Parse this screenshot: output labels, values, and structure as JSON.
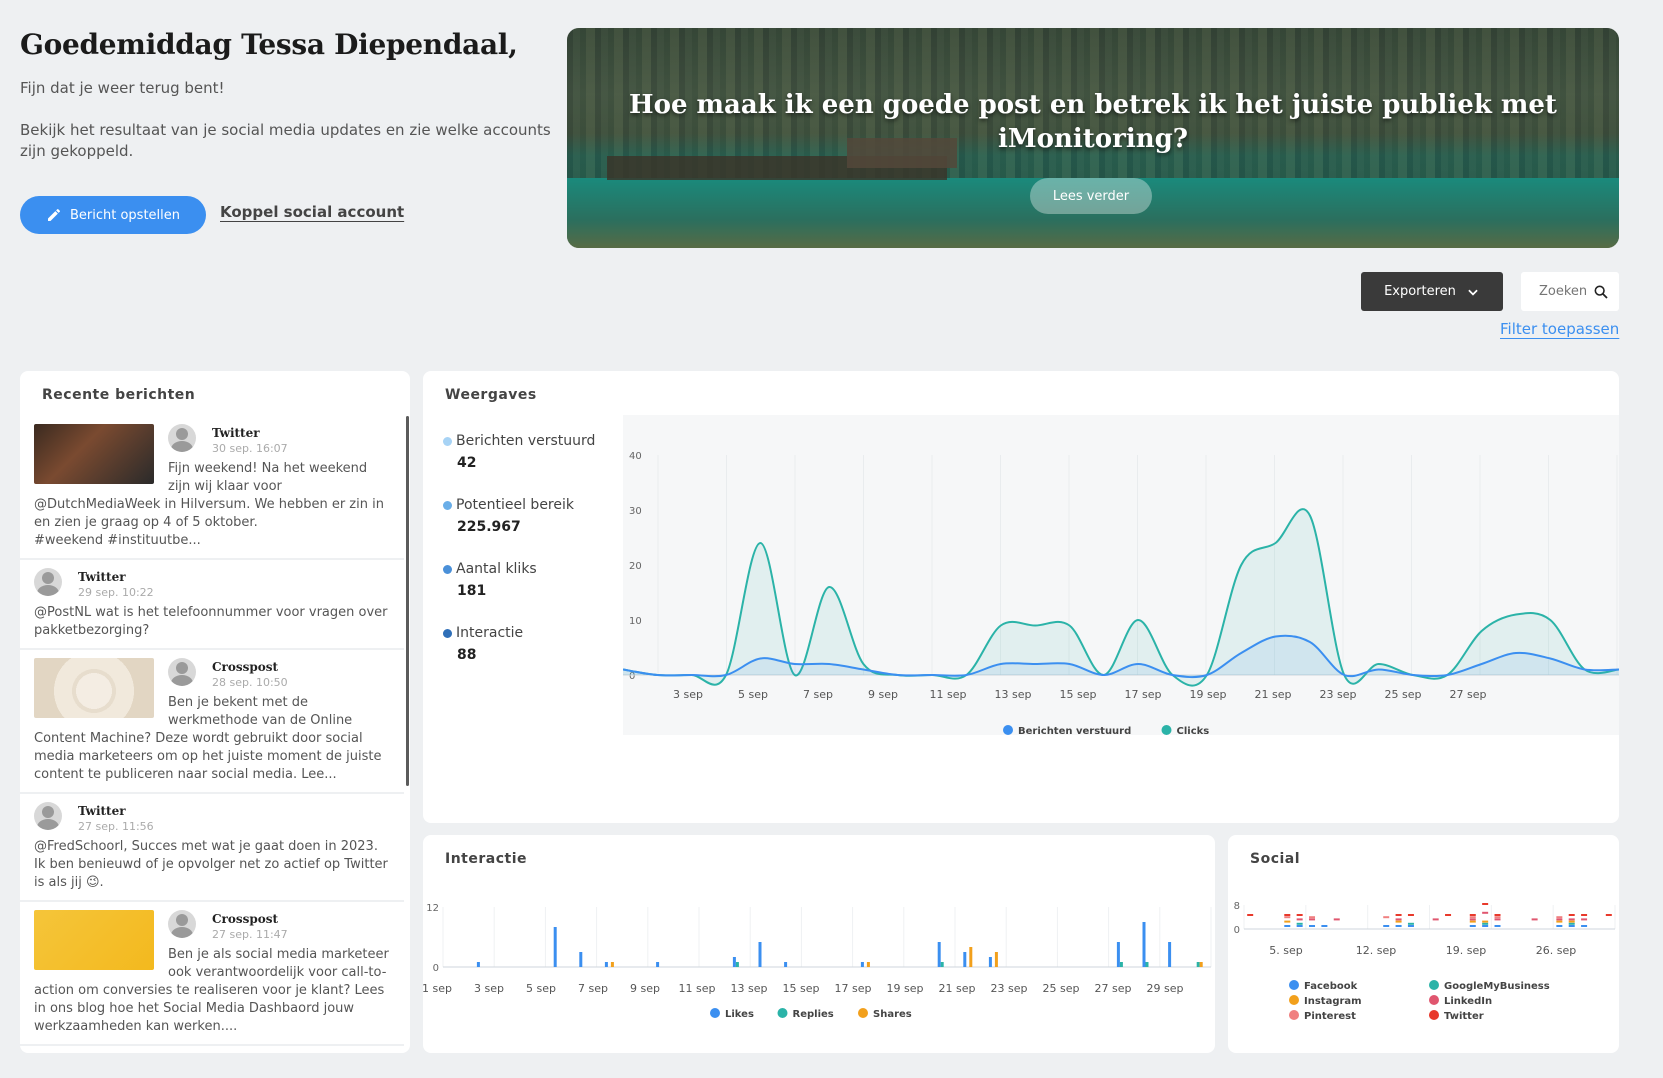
{
  "header": {
    "greeting": "Goedemiddag Tessa Diependaal,",
    "subtitle": "Fijn dat je weer terug bent!",
    "description": "Bekijk het resultaat van je social media updates en zie welke accounts zijn gekoppeld.",
    "compose_label": "Bericht opstellen",
    "connect_label": "Koppel social account"
  },
  "hero": {
    "title": "Hoe maak ik een goede post en betrek ik het juiste publiek met iMonitoring?",
    "button": "Lees verder"
  },
  "toolbar": {
    "export_label": "Exporteren",
    "search_placeholder": "Zoeken",
    "filter_label": "Filter toepassen"
  },
  "recent": {
    "title": "Recente berichten",
    "posts": [
      {
        "network": "Twitter",
        "time": "30 sep. 16:07",
        "text": "Fijn weekend! Na het weekend zijn wij klaar voor @DutchMediaWeek in Hilversum. We hebben er zin in en zien je graag op 4 of 5 oktober.",
        "text2": "#weekend #instituutbe...",
        "thumb": "photo"
      },
      {
        "network": "Twitter",
        "time": "29 sep. 10:22",
        "text": "@PostNL wat is het telefoonnummer voor vragen over pakketbezorging?",
        "thumb": "none"
      },
      {
        "network": "Crosspost",
        "time": "28 sep. 10:50",
        "text": "Ben je bekent met de werkmethode van de Online Content Machine? Deze wordt gebruikt door social media marketeers om op het juiste moment de juiste content te publiceren naar social media. Lee...",
        "thumb": "diagram"
      },
      {
        "network": "Twitter",
        "time": "27 sep. 11:56",
        "text": "@FredSchoorl, Succes met wat je gaat doen in 2023. Ik ben benieuwd of je opvolger net zo actief op Twitter is als jij 😉.",
        "thumb": "none"
      },
      {
        "network": "Crosspost",
        "time": "27 sep. 11:47",
        "text": "Ben je als social media marketeer ook verantwoordelijk voor call-to-action om conversies te realiseren voor je klant? Lees in ons blog hoe het Social Media Dashbaord jouw werkzaamheden kan werken....",
        "thumb": "yellow"
      }
    ]
  },
  "views": {
    "title": "Weergaves",
    "stats": [
      {
        "label": "Berichten verstuurd",
        "value": "42",
        "color": "#a7d3f5"
      },
      {
        "label": "Potentieel bereik",
        "value": "225.967",
        "color": "#6aaee8"
      },
      {
        "label": "Aantal kliks",
        "value": "181",
        "color": "#4a90d9"
      },
      {
        "label": "Interactie",
        "value": "88",
        "color": "#2f6fb8"
      }
    ]
  },
  "interactie": {
    "title": "Interactie"
  },
  "social": {
    "title": "Social"
  },
  "chart_data": [
    {
      "type": "area",
      "title": "Weergaves",
      "x": [
        1,
        2,
        3,
        4,
        5,
        6,
        7,
        8,
        9,
        10,
        11,
        12,
        13,
        14,
        15,
        16,
        17,
        18,
        19,
        20,
        21,
        22,
        23,
        24,
        25,
        26,
        27,
        28,
        29,
        30
      ],
      "tick_labels": [
        "3 sep",
        "5 sep",
        "7 sep",
        "9 sep",
        "11 sep",
        "13 sep",
        "15 sep",
        "17 sep",
        "19 sep",
        "21 sep",
        "23 sep",
        "25 sep",
        "27 sep"
      ],
      "ylim": [
        0,
        40
      ],
      "yticks": [
        0,
        10,
        20,
        30,
        40
      ],
      "series": [
        {
          "name": "Berichten verstuurd",
          "color": "#3b8ff0",
          "values": [
            1,
            0,
            0,
            0,
            3,
            2,
            2,
            1,
            0,
            0,
            0,
            2,
            2,
            2,
            0,
            2,
            0,
            0,
            4,
            7,
            6,
            0,
            1,
            0,
            0,
            2,
            4,
            3,
            1,
            1
          ]
        },
        {
          "name": "Clicks",
          "color": "#2bb3a8",
          "values": [
            1,
            0,
            0,
            0,
            24,
            0,
            16,
            2,
            0,
            0,
            0,
            9,
            9,
            9,
            0,
            10,
            0,
            0,
            20,
            24,
            29,
            0,
            2,
            0,
            0,
            8,
            11,
            10,
            1,
            1
          ]
        }
      ],
      "legend": "bottom"
    },
    {
      "type": "bar",
      "title": "Interactie",
      "tick_labels": [
        "1 sep",
        "3 sep",
        "5 sep",
        "7 sep",
        "9 sep",
        "11 sep",
        "13 sep",
        "15 sep",
        "17 sep",
        "19 sep",
        "21 sep",
        "23 sep",
        "25 sep",
        "27 sep",
        "29 sep"
      ],
      "ylim": [
        0,
        12
      ],
      "yticks": [
        0,
        12
      ],
      "categories_count": 30,
      "series": [
        {
          "name": "Likes",
          "color": "#3b8ff0",
          "values": [
            0,
            1,
            0,
            0,
            8,
            3,
            1,
            0,
            1,
            0,
            0,
            2,
            5,
            1,
            0,
            0,
            1,
            0,
            0,
            5,
            3,
            2,
            0,
            0,
            0,
            0,
            5,
            9,
            5,
            0
          ]
        },
        {
          "name": "Replies",
          "color": "#2bb3a8",
          "values": [
            0,
            0,
            0,
            0,
            0,
            0,
            0,
            0,
            0,
            0,
            0,
            1,
            0,
            0,
            0,
            0,
            0,
            0,
            0,
            1,
            0,
            0,
            0,
            0,
            0,
            0,
            1,
            1,
            0,
            1
          ]
        },
        {
          "name": "Shares",
          "color": "#f2a01c",
          "values": [
            0,
            0,
            0,
            0,
            0,
            0,
            1,
            0,
            0,
            0,
            0,
            0,
            0,
            0,
            0,
            0,
            1,
            0,
            0,
            0,
            4,
            3,
            0,
            0,
            0,
            0,
            0,
            0,
            0,
            1
          ]
        }
      ],
      "legend": "bottom"
    },
    {
      "type": "bar",
      "title": "Social",
      "tick_labels": [
        "5. sep",
        "12. sep",
        "19. sep",
        "26. sep"
      ],
      "ylim": [
        0,
        8
      ],
      "yticks": [
        0,
        8
      ],
      "categories_count": 30,
      "series": [
        {
          "name": "Facebook",
          "color": "#3b8ff0",
          "values": [
            0,
            0,
            0,
            1,
            1,
            1,
            1,
            0,
            0,
            0,
            0,
            1,
            1,
            1,
            0,
            0,
            0,
            0,
            1,
            1,
            1,
            0,
            0,
            0,
            0,
            1,
            1,
            1,
            0,
            0
          ]
        },
        {
          "name": "GoogleMyBusiness",
          "color": "#2bb3a8",
          "values": [
            0,
            0,
            0,
            0,
            1,
            0,
            0,
            0,
            0,
            0,
            0,
            0,
            0,
            1,
            0,
            0,
            0,
            0,
            0,
            1,
            0,
            0,
            0,
            0,
            0,
            0,
            1,
            0,
            0,
            0
          ]
        },
        {
          "name": "Instagram",
          "color": "#f2a01c",
          "values": [
            0,
            0,
            0,
            1,
            0,
            0,
            0,
            0,
            0,
            0,
            0,
            0,
            1,
            0,
            0,
            0,
            0,
            0,
            1,
            1,
            0,
            0,
            0,
            0,
            0,
            1,
            1,
            0,
            0,
            0
          ]
        },
        {
          "name": "LinkedIn",
          "color": "#e0566f",
          "values": [
            0,
            0,
            0,
            0,
            1,
            1,
            0,
            1,
            0,
            0,
            0,
            0,
            1,
            0,
            0,
            1,
            0,
            0,
            1,
            2,
            1,
            0,
            0,
            1,
            0,
            1,
            1,
            1,
            0,
            0
          ]
        },
        {
          "name": "Pinterest",
          "color": "#f08080",
          "values": [
            0,
            0,
            0,
            1,
            0,
            1,
            0,
            0,
            0,
            0,
            0,
            1,
            0,
            0,
            0,
            0,
            0,
            0,
            1,
            0,
            1,
            0,
            0,
            0,
            0,
            1,
            0,
            0,
            0,
            0
          ]
        },
        {
          "name": "Twitter",
          "color": "#e8392b",
          "values": [
            1,
            0,
            0,
            1,
            1,
            0,
            0,
            0,
            0,
            0,
            0,
            0,
            1,
            1,
            0,
            0,
            1,
            0,
            1,
            2,
            1,
            0,
            0,
            0,
            0,
            0,
            1,
            1,
            0,
            1
          ]
        }
      ],
      "legend": "bottom"
    }
  ]
}
